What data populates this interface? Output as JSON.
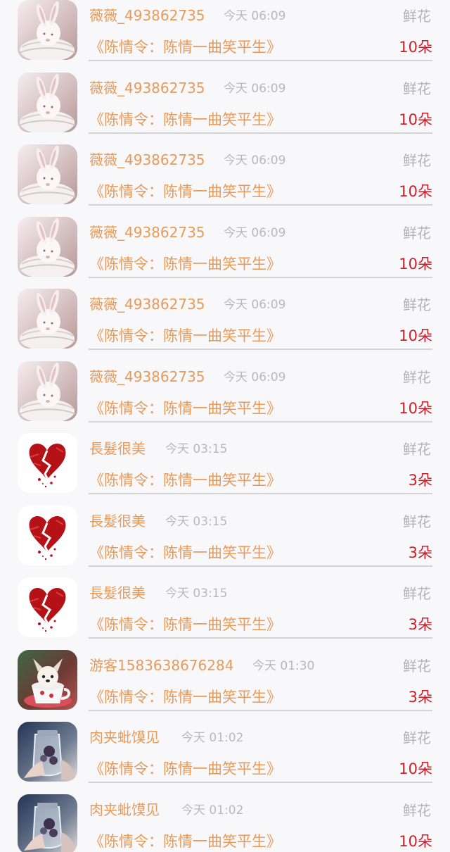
{
  "entries": [
    {
      "username": "薇薇_493862735",
      "time": "今天 06:09",
      "gift": "鲜花",
      "book": "《陈情令：陈情一曲笑平生》",
      "count": "10朵",
      "avatar_icon": "rabbit-avatar-icon"
    },
    {
      "username": "薇薇_493862735",
      "time": "今天 06:09",
      "gift": "鲜花",
      "book": "《陈情令：陈情一曲笑平生》",
      "count": "10朵",
      "avatar_icon": "rabbit-avatar-icon"
    },
    {
      "username": "薇薇_493862735",
      "time": "今天 06:09",
      "gift": "鲜花",
      "book": "《陈情令：陈情一曲笑平生》",
      "count": "10朵",
      "avatar_icon": "rabbit-avatar-icon"
    },
    {
      "username": "薇薇_493862735",
      "time": "今天 06:09",
      "gift": "鲜花",
      "book": "《陈情令：陈情一曲笑平生》",
      "count": "10朵",
      "avatar_icon": "rabbit-avatar-icon"
    },
    {
      "username": "薇薇_493862735",
      "time": "今天 06:09",
      "gift": "鲜花",
      "book": "《陈情令：陈情一曲笑平生》",
      "count": "10朵",
      "avatar_icon": "rabbit-avatar-icon"
    },
    {
      "username": "薇薇_493862735",
      "time": "今天 06:09",
      "gift": "鲜花",
      "book": "《陈情令：陈情一曲笑平生》",
      "count": "10朵",
      "avatar_icon": "rabbit-avatar-icon"
    },
    {
      "username": "長髮很美",
      "time": "今天 03:15",
      "gift": "鲜花",
      "book": "《陈情令：陈情一曲笑平生》",
      "count": "3朵",
      "avatar_icon": "broken-heart-avatar-icon"
    },
    {
      "username": "長髮很美",
      "time": "今天 03:15",
      "gift": "鲜花",
      "book": "《陈情令：陈情一曲笑平生》",
      "count": "3朵",
      "avatar_icon": "broken-heart-avatar-icon"
    },
    {
      "username": "長髮很美",
      "time": "今天 03:15",
      "gift": "鲜花",
      "book": "《陈情令：陈情一曲笑平生》",
      "count": "3朵",
      "avatar_icon": "broken-heart-avatar-icon"
    },
    {
      "username": "游客1583638676284",
      "time": "今天 01:30",
      "gift": "鲜花",
      "book": "《陈情令：陈情一曲笑平生》",
      "count": "3朵",
      "avatar_icon": "puppy-teacup-avatar-icon"
    },
    {
      "username": "肉夹蚍馍见",
      "time": "今天 01:02",
      "gift": "鲜花",
      "book": "《陈情令：陈情一曲笑平生》",
      "count": "10朵",
      "avatar_icon": "glass-jar-avatar-icon"
    },
    {
      "username": "肉夹蚍馍见",
      "time": "今天 01:02",
      "gift": "鲜花",
      "book": "《陈情令：陈情一曲笑平生》",
      "count": "10朵",
      "avatar_icon": "glass-jar-avatar-icon"
    }
  ],
  "colors": {
    "background": "#f8f7f9",
    "username": "#e89a59",
    "book_title": "#e89a59",
    "time": "#b9b9b9",
    "gift": "#b3b3b3",
    "count": "#c81f2a",
    "divider": "#d4d4d4"
  }
}
